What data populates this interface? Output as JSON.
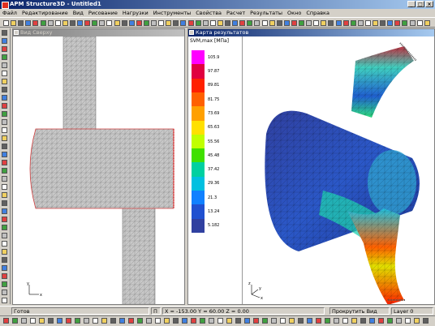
{
  "app": {
    "title": "APM Structure3D - Untitled1"
  },
  "menu": [
    "Файл",
    "Редактирование",
    "Вид",
    "Рисование",
    "Нагрузки",
    "Инструменты",
    "Свойства",
    "Расчет",
    "Результаты",
    "Окно",
    "Справка"
  ],
  "windows": {
    "top_view": {
      "title": "Вид Сверху"
    },
    "results": {
      "title": "Карта результатов"
    }
  },
  "legend": {
    "title": "SVM,max [МПа]",
    "values": [
      "105.9",
      "97.87",
      "89.81",
      "81.75",
      "73.69",
      "65.63",
      "55.56",
      "45.48",
      "37.42",
      "29.36",
      "21.3",
      "13.24",
      "5.182"
    ],
    "colors": [
      "#ff00ff",
      "#e00040",
      "#ff2000",
      "#ff6000",
      "#ffa000",
      "#ffe000",
      "#c0ff00",
      "#40e000",
      "#00d0a0",
      "#00c0e0",
      "#1080ff",
      "#2050d0",
      "#3040a0"
    ]
  },
  "status": {
    "ready": "Готов",
    "mode": "П",
    "coords": "X = -153.00  Y = 60.00  Z = 0.00",
    "action": "Прокрутить Вид",
    "layer": "Layer 0"
  },
  "axes": {
    "y": "y",
    "x": "x",
    "z": "z"
  }
}
